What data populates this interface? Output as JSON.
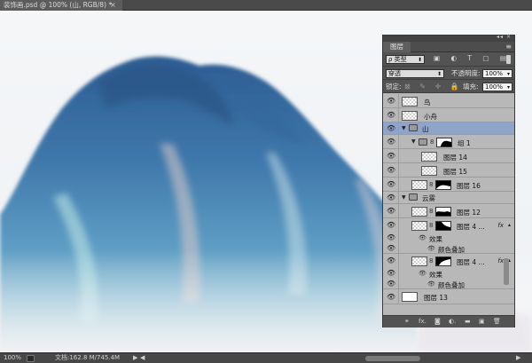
{
  "document": {
    "tab_title": "装饰画.psd @ 100% (山, RGB/8) *",
    "close_glyph": "×"
  },
  "status_bar": {
    "zoom": "100%",
    "doc_size": "文档:162.8 M/745.4M",
    "nav_arrow": "▶",
    "scroll_left": "◀",
    "scroll_right": "▶"
  },
  "layers_panel": {
    "collapse_glyphs": "◂◂ ×",
    "tab_label": "图层",
    "menu_glyph": "≡",
    "filter": {
      "kind_label": "ρ 类型",
      "kind_caret": "⬍",
      "icon_glyphs": "▣ ◐ T ▢ ▤"
    },
    "blend": {
      "mode": "穿透",
      "mode_caret": "⬍",
      "opacity_label": "不透明度:",
      "opacity_value": "100%",
      "opacity_caret": "▾"
    },
    "lock": {
      "label": "锁定:",
      "icon_glyphs": "⊠ ✎ ✛ 🔒",
      "fill_label": "填充:",
      "fill_value": "100%",
      "fill_caret": "▾"
    },
    "layers": [
      {
        "name": "鸟",
        "type": "pixel",
        "visible": true
      },
      {
        "name": "小舟",
        "type": "pixel",
        "visible": true
      },
      {
        "name": "山",
        "type": "group",
        "visible": true,
        "selected": true,
        "expanded": true
      },
      {
        "name": "组 1",
        "type": "group-masked",
        "visible": true,
        "expanded": true
      },
      {
        "name": "图层 14",
        "type": "pixel",
        "visible": true
      },
      {
        "name": "图层 15",
        "type": "pixel",
        "visible": true
      },
      {
        "name": "图层 16",
        "type": "pixel-masked",
        "visible": true
      },
      {
        "name": "云雾",
        "type": "group",
        "visible": true,
        "expanded": true
      },
      {
        "name": "图层 12",
        "type": "pixel-masked",
        "visible": true
      },
      {
        "name": "图层 4 ...",
        "type": "pixel-masked-fx",
        "visible": true,
        "fx": "fx"
      },
      {
        "name": "效果",
        "type": "effects-header",
        "visible": true
      },
      {
        "name": "颜色叠加",
        "type": "effect",
        "visible": true
      },
      {
        "name": "图层 4 ...",
        "type": "pixel-masked-fx",
        "visible": true,
        "fx": "fx"
      },
      {
        "name": "效果",
        "type": "effects-header",
        "visible": true
      },
      {
        "name": "颜色叠加",
        "type": "effect",
        "visible": true
      },
      {
        "name": "图层 13",
        "type": "pixel-white",
        "visible": true
      }
    ],
    "bottom_icons": [
      "link-layers",
      "fx",
      "add-mask",
      "adjustment",
      "new-group",
      "new-layer",
      "delete"
    ],
    "bottom_glyphs": {
      "link": "⚭",
      "fx": "fx.",
      "mask": "◙",
      "adjust": "◐.",
      "group": "▬",
      "new": "▣",
      "trash": "🗑"
    },
    "eye_glyph": "👁",
    "link_glyph": "8",
    "fx_caret": "▴",
    "disclose_glyph": "▼"
  },
  "colors": {
    "app_bg": "#535353",
    "panel_bg": "#b8b8b8",
    "selected_row": "#8ea4c8",
    "sky": "#f3f5f7",
    "mountain_deep": "#2f5f94",
    "mountain_mid": "#5d97c4",
    "mountain_light": "#9fd3df"
  }
}
